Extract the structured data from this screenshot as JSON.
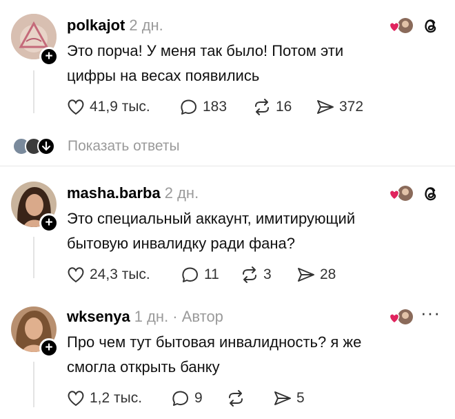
{
  "posts": [
    {
      "username": "polkajot",
      "meta": "2 дн.",
      "lines": [
        "Это порча! У меня так было! Потом эти",
        "цифры на весах появились"
      ],
      "likes": "41,9 тыс.",
      "comments": "183",
      "reposts": "16",
      "shares": "372",
      "show_replies": "Показать ответы"
    },
    {
      "username": "masha.barba",
      "meta": "2 дн.",
      "lines": [
        "Это специальный аккаунт, имитирующий",
        "бытовую инвалидку ради фана?"
      ],
      "likes": "24,3 тыс.",
      "comments": "11",
      "reposts": "3",
      "shares": "28"
    },
    {
      "username": "wksenya",
      "meta": "1 дн. · Автор",
      "lines": [
        "Про чем тут бытовая инвалидность? я же",
        "смогла открыть банку"
      ],
      "likes": "1,2 тыс.",
      "comments": "9",
      "reposts": "",
      "shares": "5"
    }
  ],
  "colors": {
    "heart": "#e0245e",
    "muted": "#9a9a9a",
    "divider": "#e6e6e6"
  },
  "icons": [
    "heart-icon",
    "comment-icon",
    "repost-icon",
    "share-icon",
    "threads-icon",
    "more-icon",
    "plus-icon",
    "arrow-down-icon"
  ]
}
